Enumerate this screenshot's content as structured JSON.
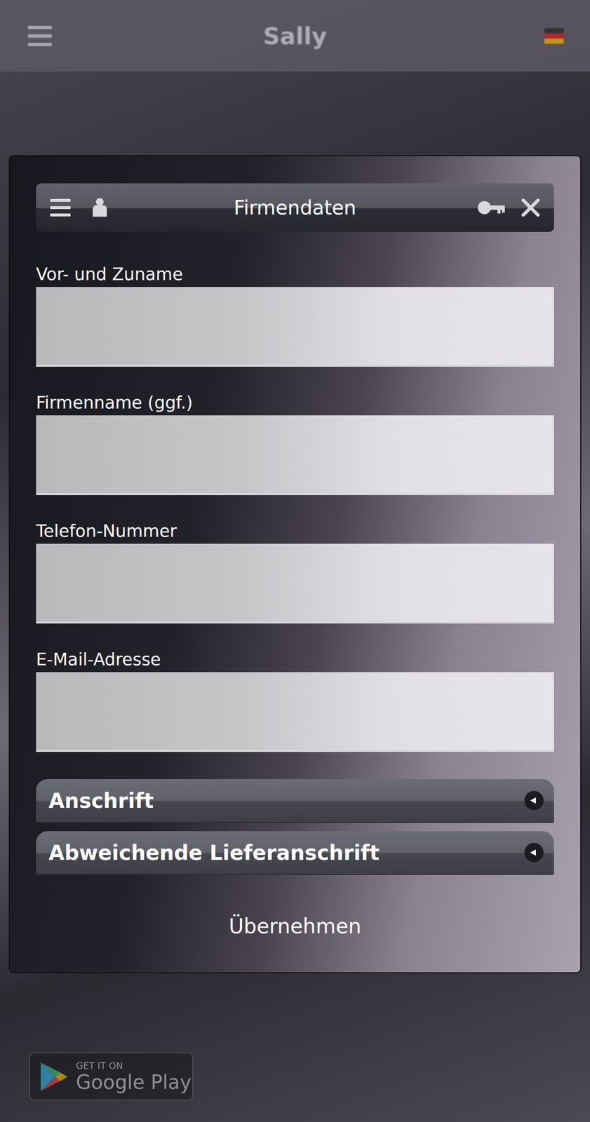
{
  "top_bar": {
    "title": "Sally"
  },
  "dialog": {
    "title": "Firmendaten",
    "fields": [
      {
        "label": "Vor- und Zuname",
        "value": ""
      },
      {
        "label": "Firmenname (ggf.)",
        "value": ""
      },
      {
        "label": "Telefon-Nummer",
        "value": ""
      },
      {
        "label": "E-Mail-Adresse",
        "value": ""
      }
    ],
    "sections": [
      {
        "label": "Anschrift",
        "expanded": false
      },
      {
        "label": "Abweichende Lieferanschrift",
        "expanded": false
      }
    ],
    "submit": "Übernehmen"
  },
  "store_badge": {
    "small": "GET IT ON",
    "large": "Google Play"
  }
}
